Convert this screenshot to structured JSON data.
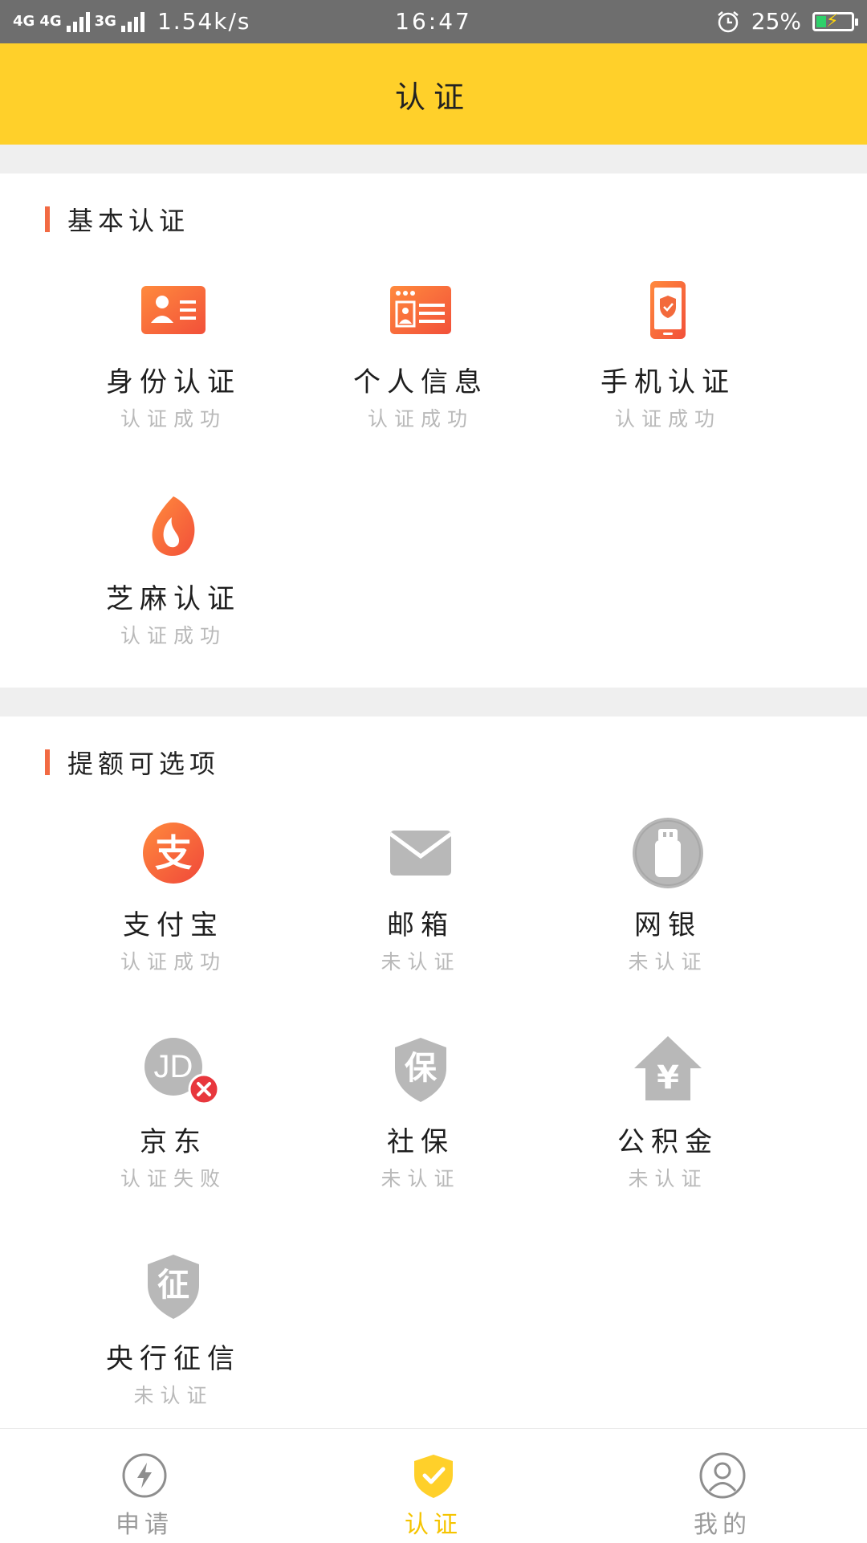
{
  "status_bar": {
    "network_left": "4G",
    "network_mid": "4G",
    "network_3g": "3G",
    "speed": "1.54k/s",
    "time": "16:47",
    "battery": "25%"
  },
  "header": {
    "title": "认证"
  },
  "basic": {
    "title": "基本认证",
    "items": [
      {
        "label": "身份认证",
        "status": "认证成功",
        "icon": "id-card-icon"
      },
      {
        "label": "个人信息",
        "status": "认证成功",
        "icon": "browser-profile-icon"
      },
      {
        "label": "手机认证",
        "status": "认证成功",
        "icon": "phone-shield-icon"
      },
      {
        "label": "芝麻认证",
        "status": "认证成功",
        "icon": "sesame-icon"
      }
    ]
  },
  "optional": {
    "title": "提额可选项",
    "items": [
      {
        "label": "支付宝",
        "status": "认证成功",
        "icon": "alipay-icon"
      },
      {
        "label": "邮箱",
        "status": "未认证",
        "icon": "mail-icon"
      },
      {
        "label": "网银",
        "status": "未认证",
        "icon": "usb-key-icon"
      },
      {
        "label": "京东",
        "status": "认证失败",
        "icon": "jd-icon"
      },
      {
        "label": "社保",
        "status": "未认证",
        "icon": "social-security-icon"
      },
      {
        "label": "公积金",
        "status": "未认证",
        "icon": "housing-fund-icon"
      },
      {
        "label": "央行征信",
        "status": "未认证",
        "icon": "credit-report-icon"
      }
    ],
    "icon_text": {
      "alipay": "支",
      "jd": "JD",
      "social": "保",
      "fund": "¥",
      "credit": "征"
    }
  },
  "tabs": [
    {
      "label": "申请",
      "icon": "lightning-icon"
    },
    {
      "label": "认证",
      "icon": "shield-check-icon"
    },
    {
      "label": "我的",
      "icon": "user-icon"
    }
  ],
  "colors": {
    "accent": "#ffd02a",
    "brand_orange": "#f26a43",
    "inactive_gray": "#b5b5b5"
  }
}
